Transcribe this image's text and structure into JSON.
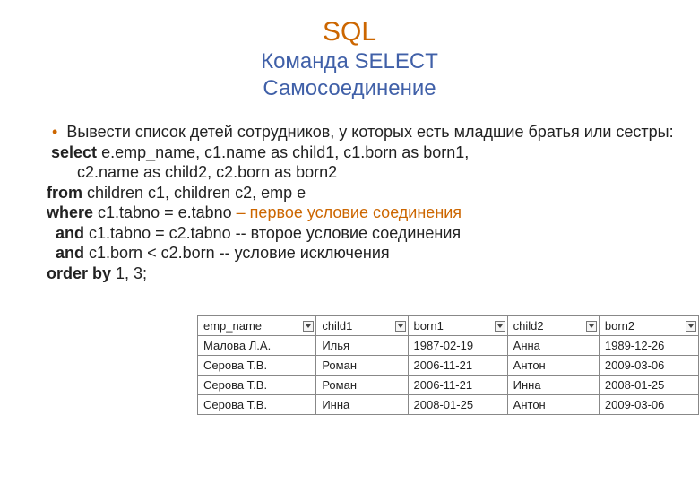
{
  "title": {
    "main": "SQL",
    "sub1": "Команда SELECT",
    "sub2": "Самосоединение"
  },
  "bullet_text": "Вывести список детей сотрудников, у которых есть младшие братья или сестры:",
  "sql": {
    "kw_select": "select",
    "select_cols": " e.emp_name, c1.name as child1, c1.born as born1,",
    "select_cols2": "c2.name as  child2, c2.born as born2",
    "kw_from": "from",
    "from_rest": " children c1, children c2, emp e",
    "kw_where": "where",
    "where1_rest": " c1.tabno = e.tabno ",
    "where1_comment": "– первое условие соединения",
    "kw_and2": "and",
    "where2_rest": " c1.tabno = c2.tabno -- второе условие соединения",
    "kw_and3": "and",
    "where3_rest": " c1.born < c2.born   -- условие исключения",
    "kw_orderby": "order by",
    "orderby_rest": " 1, 3;"
  },
  "table": {
    "headers": [
      "emp_name",
      "child1",
      "born1",
      "child2",
      "born2"
    ],
    "rows": [
      [
        "Малова Л.А.",
        "Илья",
        "1987-02-19",
        "Анна",
        "1989-12-26"
      ],
      [
        "Серова Т.В.",
        "Роман",
        "2006-11-21",
        "Антон",
        "2009-03-06"
      ],
      [
        "Серова Т.В.",
        "Роман",
        "2006-11-21",
        "Инна",
        "2008-01-25"
      ],
      [
        "Серова Т.В.",
        "Инна",
        "2008-01-25",
        "Антон",
        "2009-03-06"
      ]
    ]
  }
}
